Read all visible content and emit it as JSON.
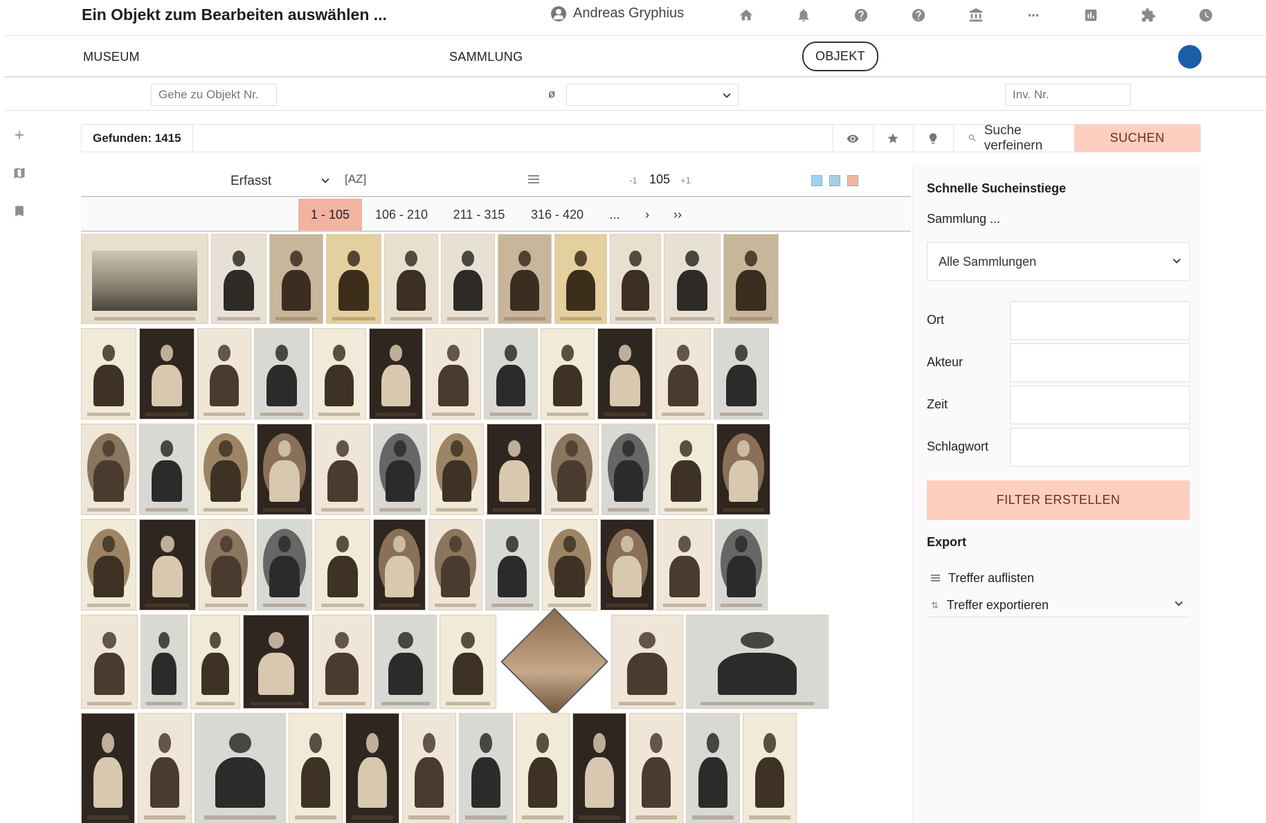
{
  "header": {
    "title": "Ein Objekt zum Bearbeiten auswählen ...",
    "user_name": "Andreas Gryphius",
    "icons": [
      "home-icon",
      "bell-icon",
      "help-icon",
      "help-icon",
      "museum-icon",
      "more-icon",
      "chart-icon",
      "puzzle-icon",
      "clock-icon"
    ]
  },
  "nav": {
    "tabs": [
      "MUSEUM",
      "SAMMLUNG",
      "OBJEKT"
    ],
    "active_tab": "OBJEKT",
    "status_color": "#1a5ea8"
  },
  "searchrow": {
    "goto_placeholder": "Gehe zu Objekt Nr.",
    "diameter_symbol": "ø",
    "select_value": "",
    "inv_placeholder": "Inv. Nr."
  },
  "results": {
    "found_label": "Gefunden: 1415",
    "refine_label": "Suche verfeinern",
    "search_button": "SUCHEN"
  },
  "gridtools": {
    "sort_value": "Erfasst",
    "az_label": "[AZ]",
    "page_minus": "-1",
    "page_size": "105",
    "page_plus": "+1"
  },
  "pagination": {
    "pages": [
      "1 - 105",
      "106 - 210",
      "211 - 315",
      "316 - 420",
      "...",
      "›",
      "››"
    ],
    "active_index": 0
  },
  "panel": {
    "title": "Schnelle Sucheinstiege",
    "sammlung_label": "Sammlung ...",
    "sammlung_value": "Alle Sammlungen",
    "fields": [
      "Ort",
      "Akteur",
      "Zeit",
      "Schlagwort"
    ],
    "filter_button": "FILTER ERSTELLEN",
    "export_title": "Export",
    "list_hits": "Treffer auflisten",
    "export_hits": "Treffer exportieren"
  },
  "colors": {
    "accent": "#fccfc0",
    "active_page": "#f2b3a1",
    "status_dot": "#1a5ea8"
  }
}
